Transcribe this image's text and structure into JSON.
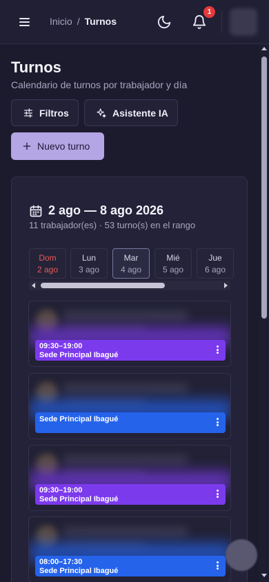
{
  "header": {
    "breadcrumb": {
      "root": "Inicio",
      "separator": "/",
      "current": "Turnos"
    },
    "notification_count": "1"
  },
  "page": {
    "title": "Turnos",
    "subtitle": "Calendario de turnos por trabajador y día"
  },
  "actions": {
    "filters_label": "Filtros",
    "ai_label": "Asistente IA",
    "new_label": "Nuevo turno"
  },
  "calendar": {
    "range": "2 ago — 8 ago 2026",
    "summary": "11 trabajador(es) · 53 turno(s) en el rango",
    "days": [
      {
        "name": "Dom",
        "date": "2 ago"
      },
      {
        "name": "Lun",
        "date": "3 ago"
      },
      {
        "name": "Mar",
        "date": "4 ago"
      },
      {
        "name": "Mié",
        "date": "5 ago"
      },
      {
        "name": "Jue",
        "date": "6 ago"
      }
    ]
  },
  "shifts": [
    {
      "time": "09:30–19:00",
      "place": "Sede Principal Ibagué",
      "color": "#7c3aed"
    },
    {
      "time": "",
      "place": "Sede Principal Ibagué",
      "color": "#2563eb"
    },
    {
      "time": "09:30–19:00",
      "place": "Sede Principal Ibagué",
      "color": "#7c3aed"
    },
    {
      "time": "08:00–17:30",
      "place": "Sede Principal Ibagué",
      "color": "#2563eb"
    }
  ],
  "colors": {
    "accent": "#b4a5e4",
    "sunday": "#e85a5a",
    "badge": "#e53a3a"
  }
}
